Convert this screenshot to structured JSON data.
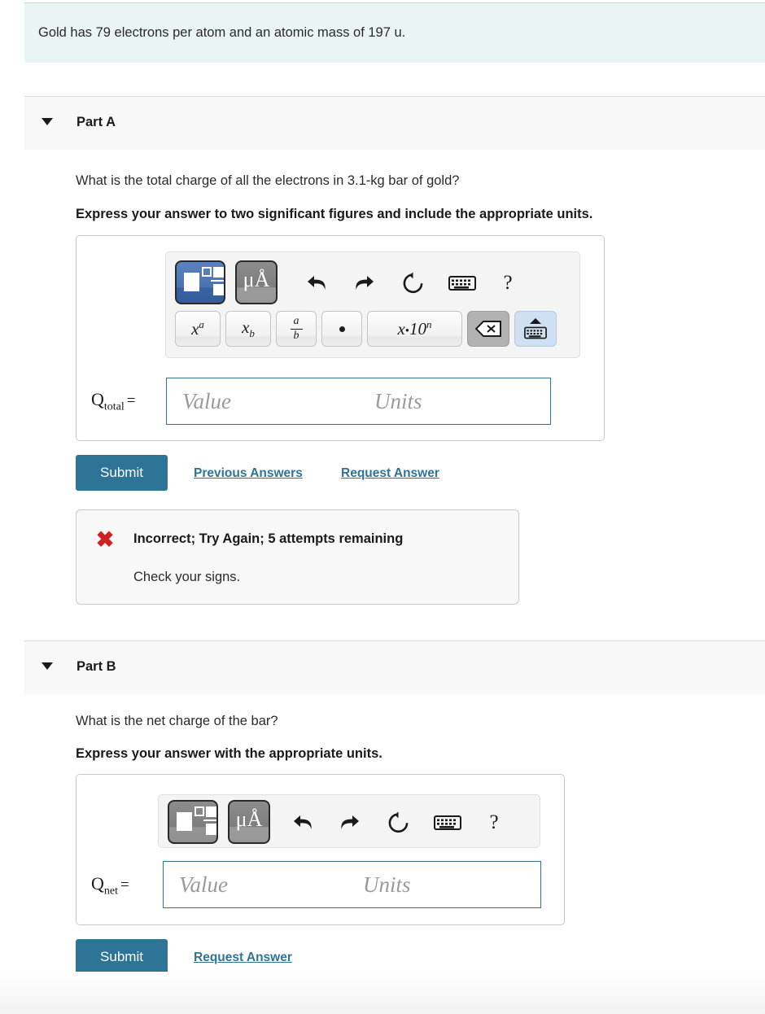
{
  "info": {
    "text": "Gold has 79 electrons per atom and an atomic mass of 197 u."
  },
  "colors": {
    "accent": "#2e7496",
    "info_bg": "#e9f4f4",
    "header_bg": "#f8f8f8",
    "error_red": "#cc2222",
    "input_border": "#37708f",
    "template_active_blue": "#4a72b2",
    "template_inactive_gray": "#8d8d8d",
    "backspace_gray": "#b2b2b2",
    "keyboard_blue": "#cfe0f2"
  },
  "parts": [
    {
      "id": "part-a",
      "title": "Part A",
      "caret": "caret-down-icon",
      "question": "What is the total charge of all the electrons in 3.1-kg bar of gold?",
      "instruction": "Express your answer to two significant figures and include the appropriate units.",
      "toolbar": {
        "template_button": {
          "name": "math-template-button",
          "state": "active",
          "label": ""
        },
        "unit_button": {
          "name": "unit-prefix-button",
          "label": "μÅ",
          "state": "inactive"
        },
        "undo": "undo-icon",
        "redo": "redo-icon",
        "reset": "reset-icon",
        "keyboard": "keyboard-icon",
        "help": "?"
      },
      "keys": [
        {
          "name": "superscript-key",
          "base": "x",
          "sup": "a"
        },
        {
          "name": "subscript-key",
          "base": "x",
          "sub": "b"
        },
        {
          "name": "fraction-key",
          "num": "a",
          "den": "b"
        },
        {
          "name": "multiply-dot-key",
          "glyph": "•"
        },
        {
          "name": "scientific-notation-key",
          "base": "x",
          "mid": "•",
          "ten": "10",
          "exp": "n"
        },
        {
          "name": "backspace-key",
          "glyph": "⌫"
        },
        {
          "name": "keyboard-toggle-key",
          "glyph": "keyboard"
        }
      ],
      "answer": {
        "label_base": "Q",
        "label_sub": "total",
        "equals": "=",
        "value_placeholder": "Value",
        "units_placeholder": "Units",
        "value": "",
        "units": ""
      },
      "actions": {
        "submit": "Submit",
        "previous_answers": "Previous Answers",
        "request_answer": "Request Answer"
      },
      "feedback": {
        "icon": "error-x-icon",
        "title": "Incorrect; Try Again; 5 attempts remaining",
        "detail": "Check your signs."
      }
    },
    {
      "id": "part-b",
      "title": "Part B",
      "caret": "caret-down-icon",
      "question": "What is the net charge of the bar?",
      "instruction": "Express your answer with the appropriate units.",
      "toolbar": {
        "template_button": {
          "name": "math-template-button",
          "state": "inactive",
          "label": ""
        },
        "unit_button": {
          "name": "unit-prefix-button",
          "label": "μÅ",
          "state": "inactive"
        },
        "undo": "undo-icon",
        "redo": "redo-icon",
        "reset": "reset-icon",
        "keyboard": "keyboard-icon",
        "help": "?"
      },
      "keys": [],
      "answer": {
        "label_base": "Q",
        "label_sub": "net",
        "equals": "=",
        "value_placeholder": "Value",
        "units_placeholder": "Units",
        "value": "",
        "units": ""
      },
      "actions": {
        "submit": "Submit",
        "request_answer": "Request Answer"
      },
      "feedback": null
    }
  ]
}
